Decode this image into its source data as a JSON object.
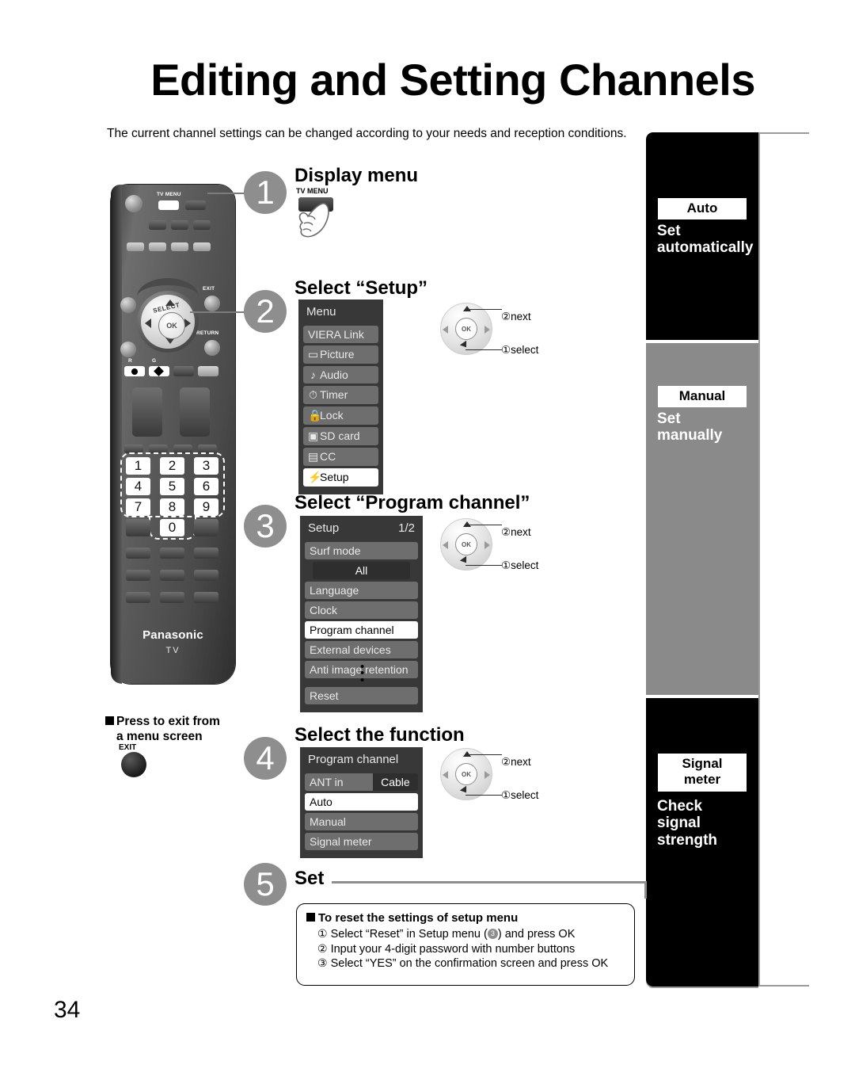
{
  "page": {
    "title": "Editing and Setting Channels",
    "intro": "The current channel settings can be changed according to your needs and reception conditions.",
    "page_number": "34"
  },
  "sidebar": {
    "sections": [
      {
        "chip": "Auto",
        "caption": "Set\nautomatically",
        "theme": "black"
      },
      {
        "chip": "Manual",
        "caption": "Set\nmanually",
        "theme": "gray"
      },
      {
        "chip": "Signal\nmeter",
        "caption": "Check\nsignal\nstrength",
        "theme": "black"
      }
    ],
    "auto_chip": "Auto",
    "auto_caption_l1": "Set",
    "auto_caption_l2": "automatically",
    "manual_chip": "Manual",
    "manual_caption_l1": "Set",
    "manual_caption_l2": "manually",
    "signal_chip_l1": "Signal",
    "signal_chip_l2": "meter",
    "signal_caption_l1": "Check",
    "signal_caption_l2": "signal",
    "signal_caption_l3": "strength"
  },
  "remote": {
    "brand": "Panasonic",
    "brand_sub": "TV",
    "tv_menu_label": "TV MENU",
    "exit_label": "EXIT",
    "return_label": "RETURN",
    "select_label": "SELECT",
    "ok_label": "OK",
    "color_r": "R",
    "color_g": "G",
    "keypad": [
      "1",
      "2",
      "3",
      "4",
      "5",
      "6",
      "7",
      "8",
      "9",
      "0"
    ]
  },
  "steps": [
    {
      "num": "1",
      "title": "Display menu"
    },
    {
      "num": "2",
      "title": "Select “Setup”"
    },
    {
      "num": "3",
      "title": "Select “Program channel”"
    },
    {
      "num": "4",
      "title": "Select the function"
    },
    {
      "num": "5",
      "title": "Set"
    }
  ],
  "step1": {
    "num": "1",
    "title": "Display menu",
    "button_label": "TV MENU"
  },
  "step2": {
    "num": "2",
    "title": "Select “Setup”",
    "menu": {
      "header": "Menu",
      "items": [
        {
          "icon": "",
          "label": "VIERA Link",
          "selected": false
        },
        {
          "icon": "▭",
          "label": "Picture",
          "selected": false
        },
        {
          "icon": "♪",
          "label": "Audio",
          "selected": false
        },
        {
          "icon": "◴",
          "label": "Timer",
          "selected": false
        },
        {
          "icon": "ὑ2",
          "label": "Lock",
          "selected": false
        },
        {
          "icon": "▤",
          "label": "SD card",
          "selected": false
        },
        {
          "icon": "▥",
          "label": "CC",
          "selected": false
        },
        {
          "icon": "⚡",
          "label": "Setup",
          "selected": true
        }
      ]
    },
    "wheel": {
      "next": "next",
      "select": "select",
      "next_num": "②",
      "select_num": "①",
      "ok": "OK"
    }
  },
  "step3": {
    "num": "3",
    "title": "Select “Program channel”",
    "menu": {
      "header": "Setup",
      "page": "1/2",
      "items": [
        {
          "label": "Surf mode",
          "selected": false,
          "sub": "All"
        },
        {
          "label": "Language",
          "selected": false
        },
        {
          "label": "Clock",
          "selected": false
        },
        {
          "label": "Program channel",
          "selected": true
        },
        {
          "label": "External devices",
          "selected": false
        },
        {
          "label": "Anti image retention",
          "selected": false
        }
      ],
      "trailing": "Reset"
    },
    "wheel": {
      "next": "next",
      "select": "select",
      "next_num": "②",
      "select_num": "①",
      "ok": "OK"
    }
  },
  "step4": {
    "num": "4",
    "title": "Select the function",
    "menu": {
      "header": "Program channel",
      "ant_label": "ANT in",
      "ant_value": "Cable",
      "items": [
        {
          "label": "Auto",
          "selected": true
        },
        {
          "label": "Manual",
          "selected": false
        },
        {
          "label": "Signal meter",
          "selected": false
        }
      ]
    },
    "wheel": {
      "next": "next",
      "select": "select",
      "next_num": "②",
      "select_num": "①",
      "ok": "OK"
    }
  },
  "step5": {
    "num": "5",
    "title": "Set"
  },
  "exit_note": {
    "line1": "Press to exit from",
    "line2": "a menu screen",
    "button_label": "EXIT"
  },
  "reset_box": {
    "title": "To reset the settings of setup menu",
    "items": [
      {
        "num": "①",
        "text_before": "Select “Reset” in Setup menu (",
        "badge": "3",
        "text_after": ") and press OK"
      },
      {
        "num": "②",
        "text": "Input your 4-digit password with number buttons"
      },
      {
        "num": "③",
        "text": "Select “YES” on the confirmation screen and press OK"
      }
    ],
    "item1_full": "Select “Reset” in Setup menu (3) and press OK",
    "item2_full": "Input your 4-digit password with number buttons",
    "item3_full": "Select “YES” on the confirmation screen and press OK"
  },
  "colors": {
    "sidebar_black": "#000000",
    "sidebar_gray": "#8a8a8a",
    "step_circle": "#8e8e8e",
    "osd_bg": "#383838",
    "osd_row": "#6e6e6e"
  }
}
